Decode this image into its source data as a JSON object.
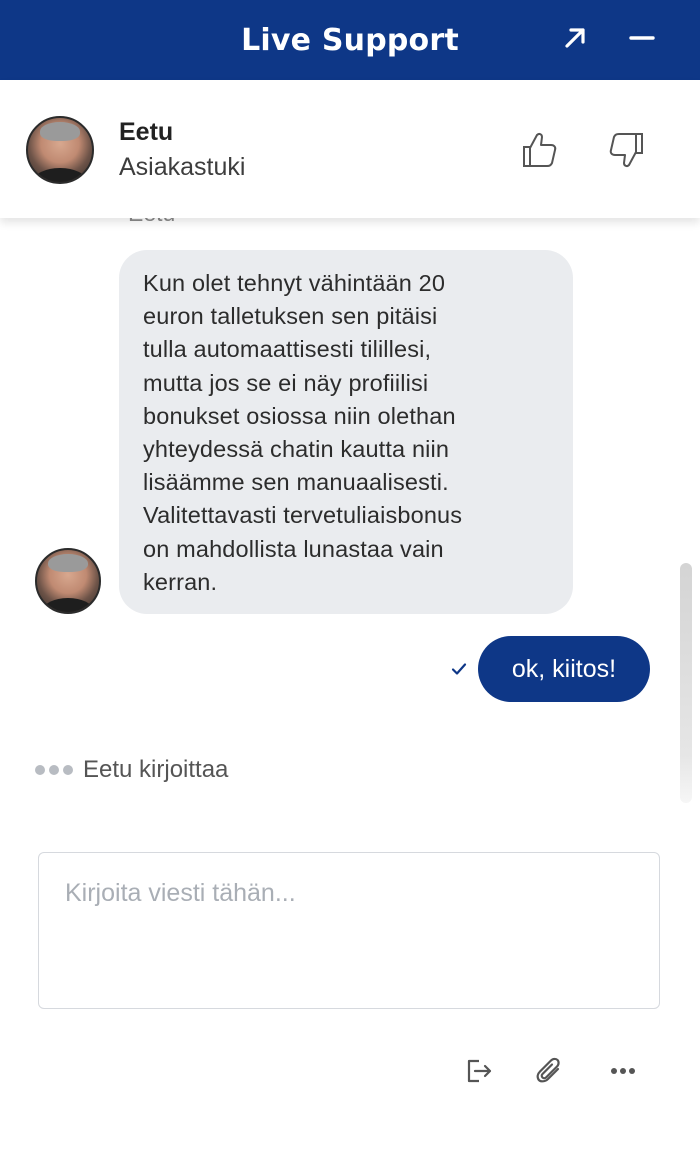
{
  "window": {
    "title": "Live Support",
    "expand_icon": "arrow-up-right-icon",
    "minimize_icon": "minimize-icon"
  },
  "agent": {
    "name": "Eetu",
    "role": "Asiakastuki",
    "rate_up_icon": "thumbs-up-icon",
    "rate_down_icon": "thumbs-down-icon"
  },
  "messages": {
    "sender_label": "Eetu",
    "agent_message_lines": [
      "Kun olet tehnyt vähintään 20",
      "euron talletuksen sen pitäisi",
      "tulla automaattisesti tilillesi,",
      "mutta jos se ei näy profiilisi",
      "bonukset osiossa niin olethan",
      "yhteydessä chatin kautta niin",
      "lisäämme sen manuaalisesti.",
      "Valitettavasti tervetuliaisbonus",
      "on mahdollista lunastaa vain",
      "kerran."
    ],
    "user_message": "ok, kiitos!",
    "delivered_icon": "checkmark-icon"
  },
  "typing_indicator": {
    "text": "Eetu kirjoittaa"
  },
  "composer": {
    "placeholder": "Kirjoita viesti tähän...",
    "value": ""
  },
  "toolbar": {
    "icons": [
      "end-chat-icon",
      "paperclip-icon",
      "more-options-icon"
    ]
  },
  "colors": {
    "brand": "#0e3787",
    "agent_bubble": "#eaecef",
    "user_bubble": "#0e3787"
  }
}
